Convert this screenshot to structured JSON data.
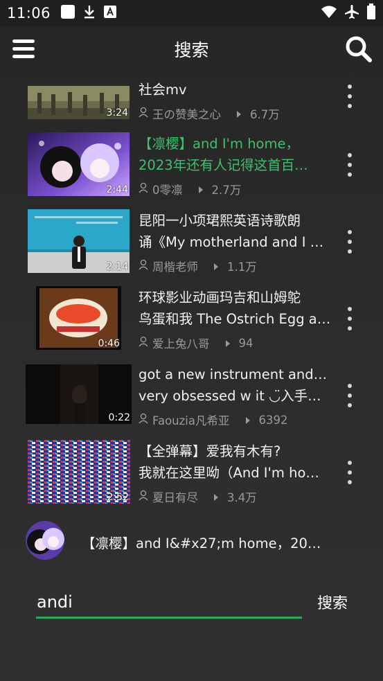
{
  "status_bar": {
    "time": "11:06",
    "icons": [
      "square-notification-icon",
      "download-icon",
      "font-a-icon",
      "wifi-icon",
      "airplane-icon",
      "battery-icon"
    ]
  },
  "app_bar": {
    "title": "搜索",
    "menu_icon": "hamburger-menu-icon",
    "search_icon": "search-icon"
  },
  "results": [
    {
      "title_lines": [
        "社会mv"
      ],
      "author": "王の赞美之心",
      "views": "6.7万",
      "duration": "3:24",
      "highlighted": false
    },
    {
      "title_lines": [
        "【凛樱】and I'm home，",
        "2023年还有人记得这首百…"
      ],
      "author": "0零凛",
      "views": "2.7万",
      "duration": "2:44",
      "highlighted": true
    },
    {
      "title_lines": [
        "昆阳一小项珺熙英语诗歌朗",
        "诵《My motherland and I …"
      ],
      "author": "周楷老师",
      "views": "1.1万",
      "duration": "2:14",
      "highlighted": false
    },
    {
      "title_lines": [
        "环球影业动画玛吉和山姆鸵",
        "鸟蛋和我 The Ostrich Egg a…"
      ],
      "author": "爱上兔八哥",
      "views": "94",
      "duration": "0:46",
      "highlighted": false
    },
    {
      "title_lines": [
        "got a new instrument and i'm",
        "very obsessed w it ◡̈入手一…"
      ],
      "author": "Faouzia凡希亚",
      "views": "6392",
      "duration": "0:22",
      "highlighted": false
    },
    {
      "title_lines": [
        "【全弹幕】爱我有木有?",
        "我就在这里呦（And I'm ho…"
      ],
      "author": "夏日有尽",
      "views": "3.4万",
      "duration": "2:52",
      "highlighted": false
    }
  ],
  "suggestion": {
    "text": "【凛樱】and I&#x27;m home，202…"
  },
  "search": {
    "value": "andi",
    "button_label": "搜索"
  },
  "colors": {
    "accent": "#2eaa5e",
    "highlight_title": "#3fbf6f",
    "background": "#2a2a2a"
  }
}
